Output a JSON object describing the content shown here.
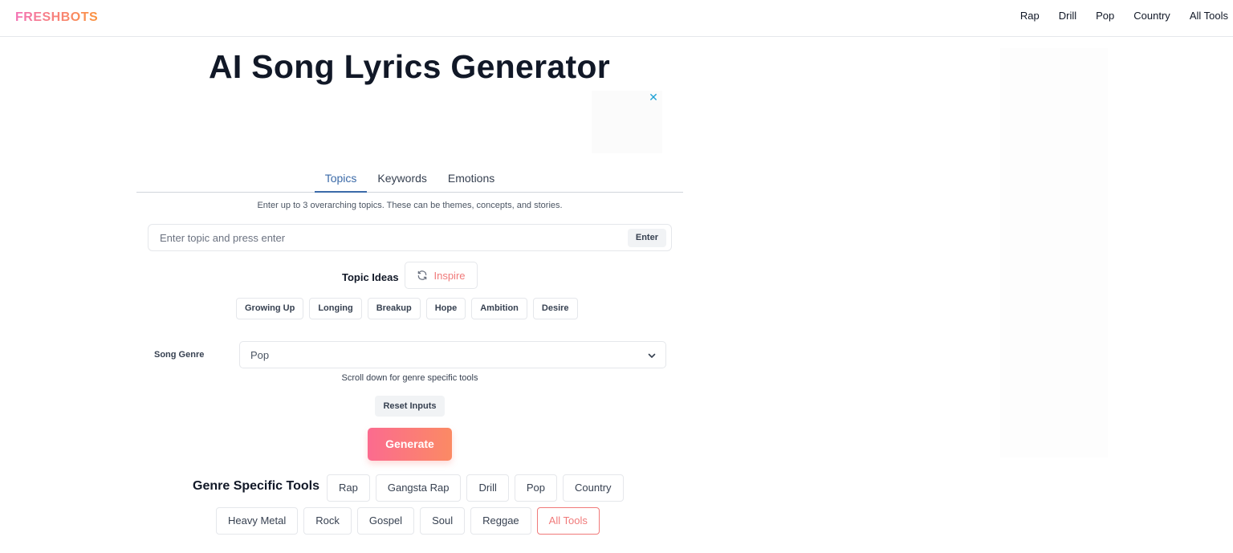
{
  "brand": {
    "name": "FRESHBOTS"
  },
  "nav": {
    "links": [
      "Rap",
      "Drill",
      "Pop",
      "Country",
      "All Tools"
    ]
  },
  "page": {
    "title": "AI Song Lyrics Generator"
  },
  "ad": {
    "close_glyph": "✕"
  },
  "tabs": {
    "items": [
      "Topics",
      "Keywords",
      "Emotions"
    ],
    "active": "Topics"
  },
  "topics": {
    "hint": "Enter up to 3 overarching topics. These can be themes, concepts, and stories.",
    "placeholder": "Enter topic and press enter",
    "enter_label": "Enter",
    "ideas_label": "Topic Ideas",
    "inspire_label": "Inspire",
    "ideas": [
      "Growing Up",
      "Longing",
      "Breakup",
      "Hope",
      "Ambition",
      "Desire"
    ]
  },
  "genre": {
    "label": "Song Genre",
    "selected": "Pop",
    "scroll_hint": "Scroll down for genre specific tools"
  },
  "actions": {
    "reset_label": "Reset Inputs",
    "generate_label": "Generate"
  },
  "genre_tools": {
    "label": "Genre Specific Tools",
    "row1": [
      "Rap",
      "Gangsta Rap",
      "Drill",
      "Pop",
      "Country"
    ],
    "row2": [
      "Heavy Metal",
      "Rock",
      "Gospel",
      "Soul",
      "Reggae",
      "All Tools"
    ]
  },
  "colors": {
    "accent_pink": "#fb6b8f",
    "accent_orange": "#fb8a64",
    "tab_active": "#3b6aa8",
    "all_tools": "#f07a7a"
  },
  "icons": {
    "inspire": "refresh-icon",
    "select": "chevron-down-icon",
    "ad_close": "close-icon"
  }
}
